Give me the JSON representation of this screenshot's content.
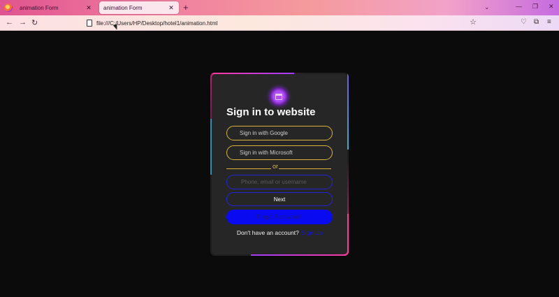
{
  "browser": {
    "tabs": [
      {
        "title": "animation Form",
        "active": false
      },
      {
        "title": "animation Form",
        "active": true
      }
    ],
    "new_tab": "+",
    "url": "file:///C:/Users/HP/Desktop/hotel1/animation.html",
    "icons": {
      "back": "back-arrow-icon",
      "forward": "forward-arrow-icon",
      "reload": "reload-icon",
      "bookmark": "star-icon",
      "pocket": "pocket-icon",
      "extensions": "puzzle-icon",
      "menu": "hamburger-icon"
    }
  },
  "form": {
    "title": "Sign in to website",
    "google_label": "Sign in with Google",
    "microsoft_label": "Sign in with Microsoft",
    "divider": "or",
    "input_placeholder": "Phone, email or username",
    "next_label": "Next",
    "forgot_label": "Forgot Password?",
    "signup_text": "Don't have an account?",
    "signup_link": "Sign Up"
  },
  "colors": {
    "page_bg": "#0b0b0b",
    "card_bg": "#262626",
    "gold": "#d8b23a",
    "blue": "#2323d8",
    "primary": "#0a0af0",
    "accent_pink": "#e8318f"
  }
}
